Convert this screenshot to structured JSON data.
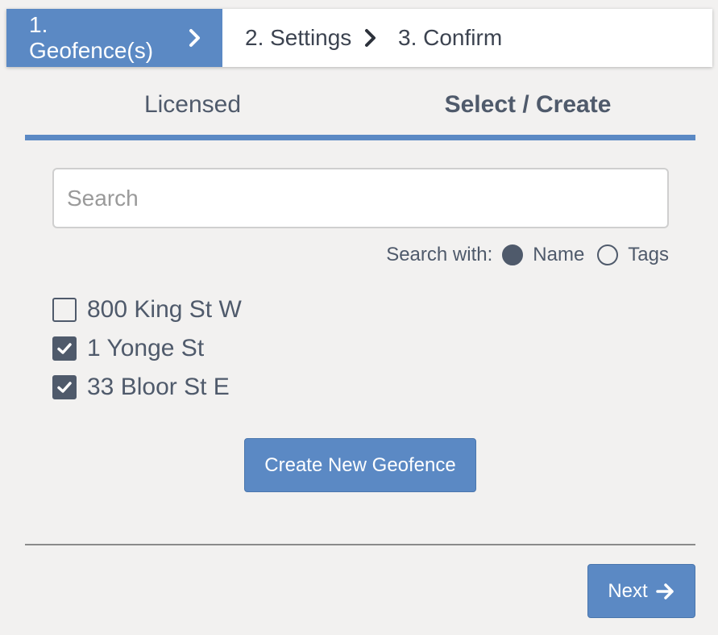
{
  "stepper": {
    "steps": [
      {
        "label": "1. Geofence(s)",
        "active": true
      },
      {
        "label": "2. Settings",
        "active": false
      },
      {
        "label": "3. Confirm",
        "active": false
      }
    ]
  },
  "tabs": {
    "licensed": "Licensed",
    "select_create": "Select / Create",
    "selected": "select_create"
  },
  "search": {
    "placeholder": "Search",
    "value": "",
    "with_label": "Search with:",
    "options": [
      {
        "label": "Name",
        "selected": true
      },
      {
        "label": "Tags",
        "selected": false
      }
    ]
  },
  "geofences": [
    {
      "label": "800 King St W",
      "checked": false
    },
    {
      "label": "1 Yonge St",
      "checked": true
    },
    {
      "label": "33 Bloor St E",
      "checked": true
    }
  ],
  "actions": {
    "create_label": "Create New Geofence",
    "next_label": "Next"
  },
  "colors": {
    "accent": "#5b89c4",
    "text": "#4f5a6b",
    "background": "#f2f1f0"
  },
  "icons": {
    "step_separator": "chevron-right-icon",
    "next": "arrow-right-icon",
    "checkbox_checked": "checkmark-icon"
  }
}
